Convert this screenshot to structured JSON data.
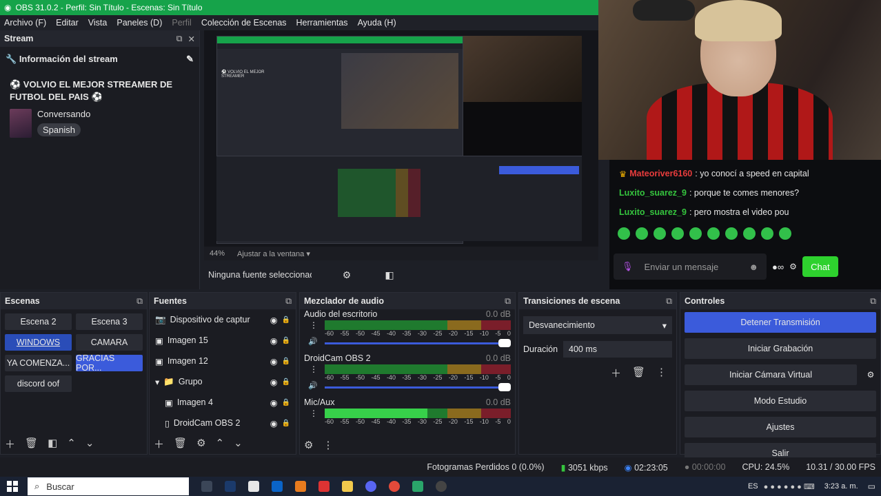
{
  "window": {
    "title": "OBS 31.0.2 - Perfil: Sin Título - Escenas: Sin Título"
  },
  "menu": [
    {
      "label": "Archivo (F)",
      "disabled": false
    },
    {
      "label": "Editar",
      "disabled": false
    },
    {
      "label": "Vista",
      "disabled": false
    },
    {
      "label": "Paneles (D)",
      "disabled": false
    },
    {
      "label": "Perfil",
      "disabled": true
    },
    {
      "label": "Colección de Escenas",
      "disabled": false
    },
    {
      "label": "Herramientas",
      "disabled": false
    },
    {
      "label": "Ayuda (H)",
      "disabled": false
    }
  ],
  "stream_dock": {
    "title": "Stream",
    "info_header": "Información del stream",
    "stream_title": "⚽ VOLVIO EL MEJOR STREAMER DE FUTBOL DEL PAIS ⚽",
    "category": "Conversando",
    "tag": "Spanish"
  },
  "preview": {
    "zoom": "44%",
    "fit_label": "Ajustar a la ventana",
    "no_source": "Ninguna fuente seleccionad"
  },
  "chat": {
    "messages": [
      {
        "user": "Mateoriver6160",
        "text": ": yo conocí a speed en capital",
        "color": "#e83c3c"
      },
      {
        "user": "Luxito_suarez_9",
        "text": ": porque te comes menores?",
        "color": "#35c43e"
      },
      {
        "user": "Luxito_suarez_9",
        "text": ": pero mostra el video pou",
        "color": "#35c43e"
      }
    ],
    "input_placeholder": "Enviar un mensaje",
    "chat_button": "Chat"
  },
  "scenes": {
    "title": "Escenas",
    "items": [
      {
        "label": "Escena 2",
        "state": ""
      },
      {
        "label": "Escena 3",
        "state": ""
      },
      {
        "label": "WINDOWS",
        "state": "active"
      },
      {
        "label": "CAMARA",
        "state": ""
      },
      {
        "label": "YA COMENZA...",
        "state": ""
      },
      {
        "label": "GRACIAS POR...",
        "state": "sel"
      },
      {
        "label": "discord oof",
        "state": ""
      }
    ]
  },
  "sources": {
    "title": "Fuentes",
    "items": [
      {
        "label": "Dispositivo de captur",
        "icon": "camera-icon",
        "indent": 0
      },
      {
        "label": "Imagen 15",
        "icon": "image-icon",
        "indent": 0
      },
      {
        "label": "Imagen 12",
        "icon": "image-icon",
        "indent": 0
      },
      {
        "label": "Grupo",
        "icon": "folder-icon",
        "indent": 0
      },
      {
        "label": "Imagen 4",
        "icon": "image-icon",
        "indent": 1
      },
      {
        "label": "DroidCam OBS 2",
        "icon": "file-icon",
        "indent": 1
      }
    ]
  },
  "mixer": {
    "title": "Mezclador de audio",
    "scale": [
      "-60",
      "-55",
      "-50",
      "-45",
      "-40",
      "-35",
      "-30",
      "-25",
      "-20",
      "-15",
      "-10",
      "-5",
      "0"
    ],
    "tracks": [
      {
        "name": "Audio del escritorio",
        "db": "0.0 dB",
        "level": 0
      },
      {
        "name": "DroidCam OBS 2",
        "db": "0.0 dB",
        "level": 0
      },
      {
        "name": "Mic/Aux",
        "db": "0.0 dB",
        "level": 0.55
      }
    ]
  },
  "transitions": {
    "title": "Transiciones de escena",
    "selected": "Desvanecimiento",
    "duration_label": "Duración",
    "duration_value": "400 ms"
  },
  "controls": {
    "title": "Controles",
    "buttons": [
      {
        "label": "Detener Transmisión",
        "primary": true
      },
      {
        "label": "Iniciar Grabación",
        "primary": false
      },
      {
        "label": "Iniciar Cámara Virtual",
        "primary": false
      },
      {
        "label": "Modo Estudio",
        "primary": false
      },
      {
        "label": "Ajustes",
        "primary": false
      },
      {
        "label": "Salir",
        "primary": false
      }
    ]
  },
  "status": {
    "dropped": "Fotogramas Perdidos 0 (0.0%)",
    "bitrate": "3051 kbps",
    "live_time": "02:23:05",
    "rec_time": "00:00:00",
    "cpu": "CPU: 24.5%",
    "fps": "10.31 / 30.00 FPS"
  },
  "taskbar": {
    "search_placeholder": "Buscar",
    "lang": "ES",
    "clock": "3:23 a. m."
  },
  "colors": {
    "accent": "#3b5bdb",
    "titlebar": "#16a34a",
    "chat_green": "#2ed12e"
  }
}
